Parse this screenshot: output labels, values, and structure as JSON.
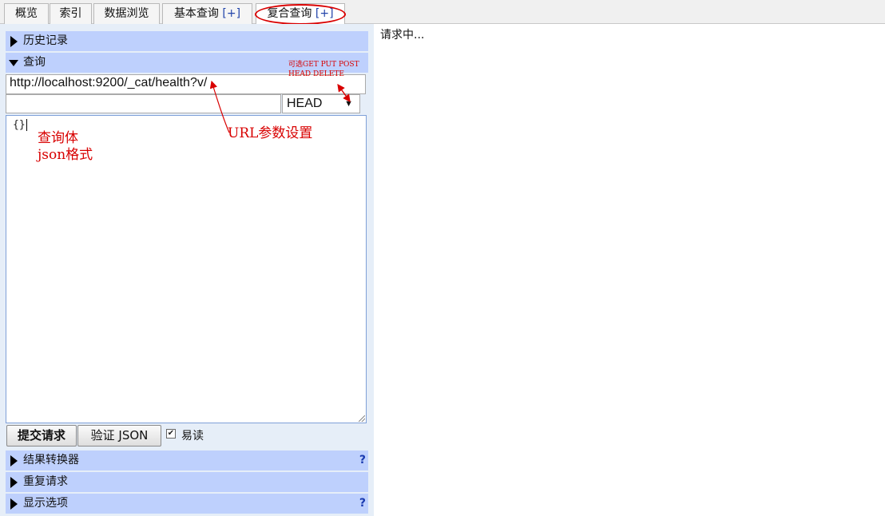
{
  "tabs": [
    {
      "label": "概览"
    },
    {
      "label": "索引"
    },
    {
      "label": "数据浏览"
    },
    {
      "label": "基本查询",
      "plus": "[+]"
    },
    {
      "label": "复合查询",
      "plus": "[+]"
    }
  ],
  "left": {
    "history_label": "历史记录",
    "query_label": "查询",
    "url_value": "http://localhost:9200/_cat/health?v/",
    "path_value": "",
    "method_value": "HEAD",
    "body_value": "{}",
    "submit_label": "提交请求",
    "validate_label": "验证 JSON",
    "readable_label": "易读",
    "readable_checked": "✔",
    "transformer_label": "结果转换器",
    "repeat_label": "重复请求",
    "display_label": "显示选项",
    "help_mark": "?"
  },
  "right": {
    "status": "请求中..."
  },
  "annotations": {
    "methods_line1": "可选GET PUT POST",
    "methods_line2": "HEAD DELETE",
    "url_params": "URL参数设置",
    "body_line1": "查询体",
    "body_line2": "json格式"
  },
  "colors": {
    "section_bar": "#bed0fd",
    "panel_bg": "#e6eef8",
    "annotation_red": "#d80000",
    "plus_blue": "#2244aa"
  },
  "icons": {
    "collapsed": "triangle-right-icon",
    "expanded": "triangle-down-icon",
    "select_arrow": "chevron-down-icon",
    "help": "question-icon"
  }
}
